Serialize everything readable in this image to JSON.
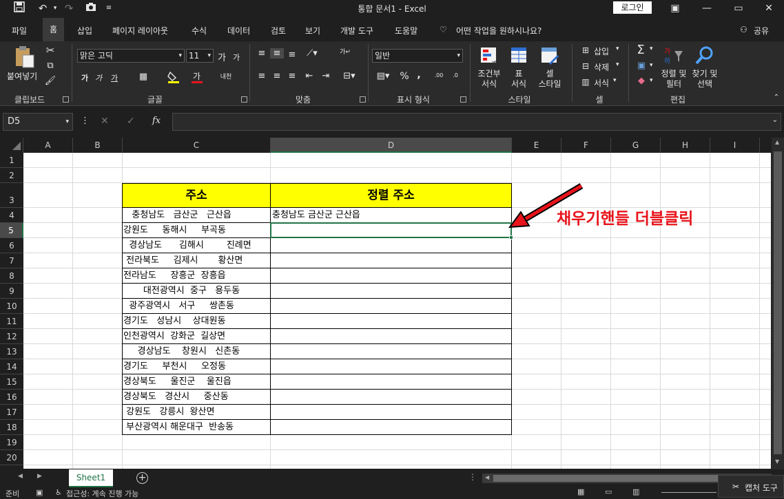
{
  "window": {
    "title": "통합 문서1  -  Excel",
    "login_label": "로그인",
    "minimize": "—",
    "restore": "▭",
    "close": "✕"
  },
  "menu": {
    "items": [
      "파일",
      "홈",
      "삽입",
      "페이지 레이아웃",
      "수식",
      "데이터",
      "검토",
      "보기",
      "개발 도구",
      "도움말"
    ],
    "active": "홈",
    "tell_me": "어떤 작업을 원하시나요?",
    "share": "공유"
  },
  "ribbon": {
    "clipboard": {
      "paste": "붙여넣기",
      "label": "클립보드"
    },
    "font": {
      "name": "맑은 고딕",
      "size": "11",
      "label": "글꼴"
    },
    "align": {
      "wrap": "자동 줄 바꿈",
      "label": "맞춤"
    },
    "number": {
      "format": "일반",
      "label": "표시 형식"
    },
    "styles": {
      "cond": "조건부\n서식",
      "table": "표\n서식",
      "cell": "셀\n스타일",
      "label": "스타일"
    },
    "cells": {
      "insert": "삽입",
      "delete": "삭제",
      "format": "서식",
      "label": "셀"
    },
    "edit": {
      "sort": "정렬 및\n필터",
      "find": "찾기 및\n선택",
      "label": "편집"
    }
  },
  "formula_bar": {
    "name_box": "D5",
    "fx": "fx",
    "value": ""
  },
  "grid": {
    "columns": [
      "A",
      "B",
      "C",
      "D",
      "E",
      "F",
      "G",
      "H",
      "I"
    ],
    "selected_column": "D",
    "rows": [
      "1",
      "2",
      "3",
      "4",
      "5",
      "6",
      "7",
      "8",
      "9",
      "10",
      "11",
      "12",
      "13",
      "14",
      "15",
      "16",
      "17",
      "18",
      "19",
      "20"
    ],
    "selected_row": "5",
    "header_c": "주소",
    "header_d": "정렬 주소",
    "addresses": [
      "   충청남도   금산군   근산읍",
      "강원도     동해시     부곡동",
      "  경상남도      김해시        진례면",
      " 전라북도     김제시       황산면",
      "전라남도     장흥군  장흥읍",
      "       대전광역시  중구   용두동",
      "  광주광역시   서구     쌍촌동",
      "경기도   성남시    상대원동",
      "인천광역시  강화군  길상면",
      "     경상남도    창원시   신촌동",
      "경기도     부천시     오정동",
      "경상북도     울진군    울진읍",
      "경상북도   경산시     중산동",
      " 강원도   강릉시  왕산면",
      " 부산광역시 해운대구  반송동"
    ],
    "sorted": [
      "충청남도 금산군 근산읍"
    ]
  },
  "annotation": {
    "text": "채우기핸들 더블클릭",
    "color": "#e8141b"
  },
  "sheet_tabs": {
    "active": "Sheet1"
  },
  "status_bar": {
    "ready": "준비",
    "accessibility": "접근성: 계속 진행 가능",
    "capture_tool": "캡처 도구"
  },
  "colors": {
    "header_fill": "#ffff00",
    "accent": "#217346"
  }
}
